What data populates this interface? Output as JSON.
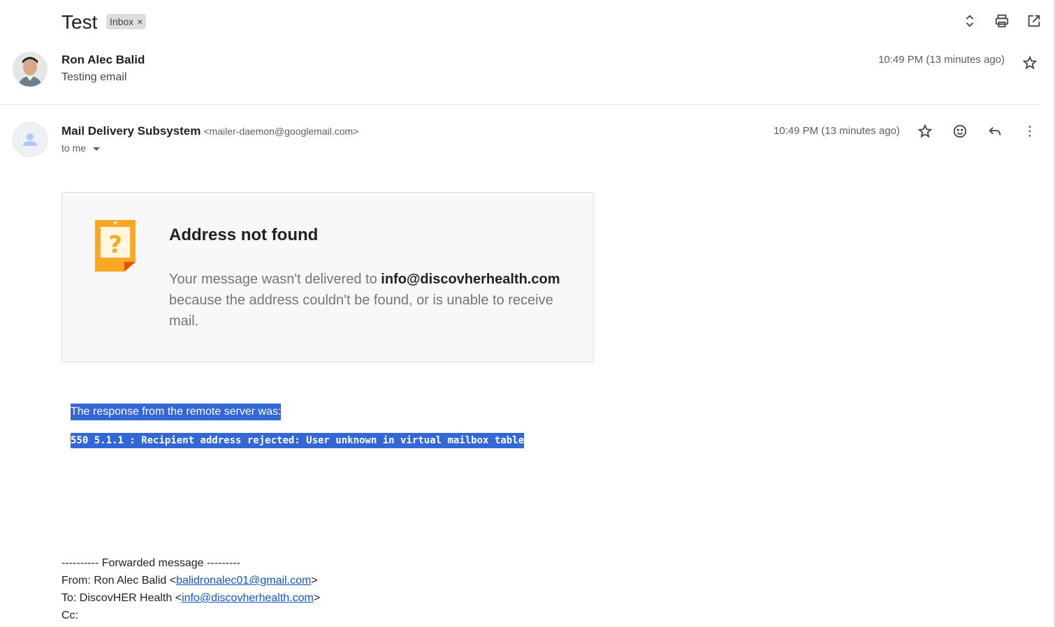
{
  "thread": {
    "subject": "Test",
    "label": "Inbox",
    "label_remove": "×"
  },
  "toolbar": {
    "icons": [
      "expand-collapse-icon",
      "print-icon",
      "open-in-new-window-icon"
    ]
  },
  "message1": {
    "sender": "Ron Alec Balid",
    "snippet": "Testing email",
    "time": "10:49 PM (13 minutes ago)"
  },
  "message2": {
    "sender": "Mail Delivery Subsystem",
    "sender_email": "<mailer-daemon@googlemail.com>",
    "recipient": "to me",
    "time": "10:49 PM (13 minutes ago)",
    "icons": [
      "star-icon",
      "emoji-reaction-icon",
      "reply-icon",
      "more-vert-icon"
    ]
  },
  "bounce": {
    "title": "Address not found",
    "body_prefix": "Your message wasn't delivered to ",
    "address": "info@discovherhealth.com",
    "body_suffix": " because the address couldn't be found, or is unable to receive mail."
  },
  "server_response": {
    "label": "The response from the remote server was:",
    "code": "550 5.1.1 : Recipient address rejected: User unknown in virtual mailbox table"
  },
  "forwarded": {
    "header": "---------- Forwarded message ---------",
    "from_label": "From: Ron Alec Balid <",
    "from_email": "balidronalec01@gmail.com",
    "from_close": ">",
    "to_label": "To: DiscovHER Health <",
    "to_email": "info@discovherhealth.com",
    "to_close": ">",
    "cc_label": "Cc:"
  },
  "colors": {
    "selection": "#3367d6",
    "bounce_icon": "#f9a825",
    "link": "#1155cc"
  }
}
